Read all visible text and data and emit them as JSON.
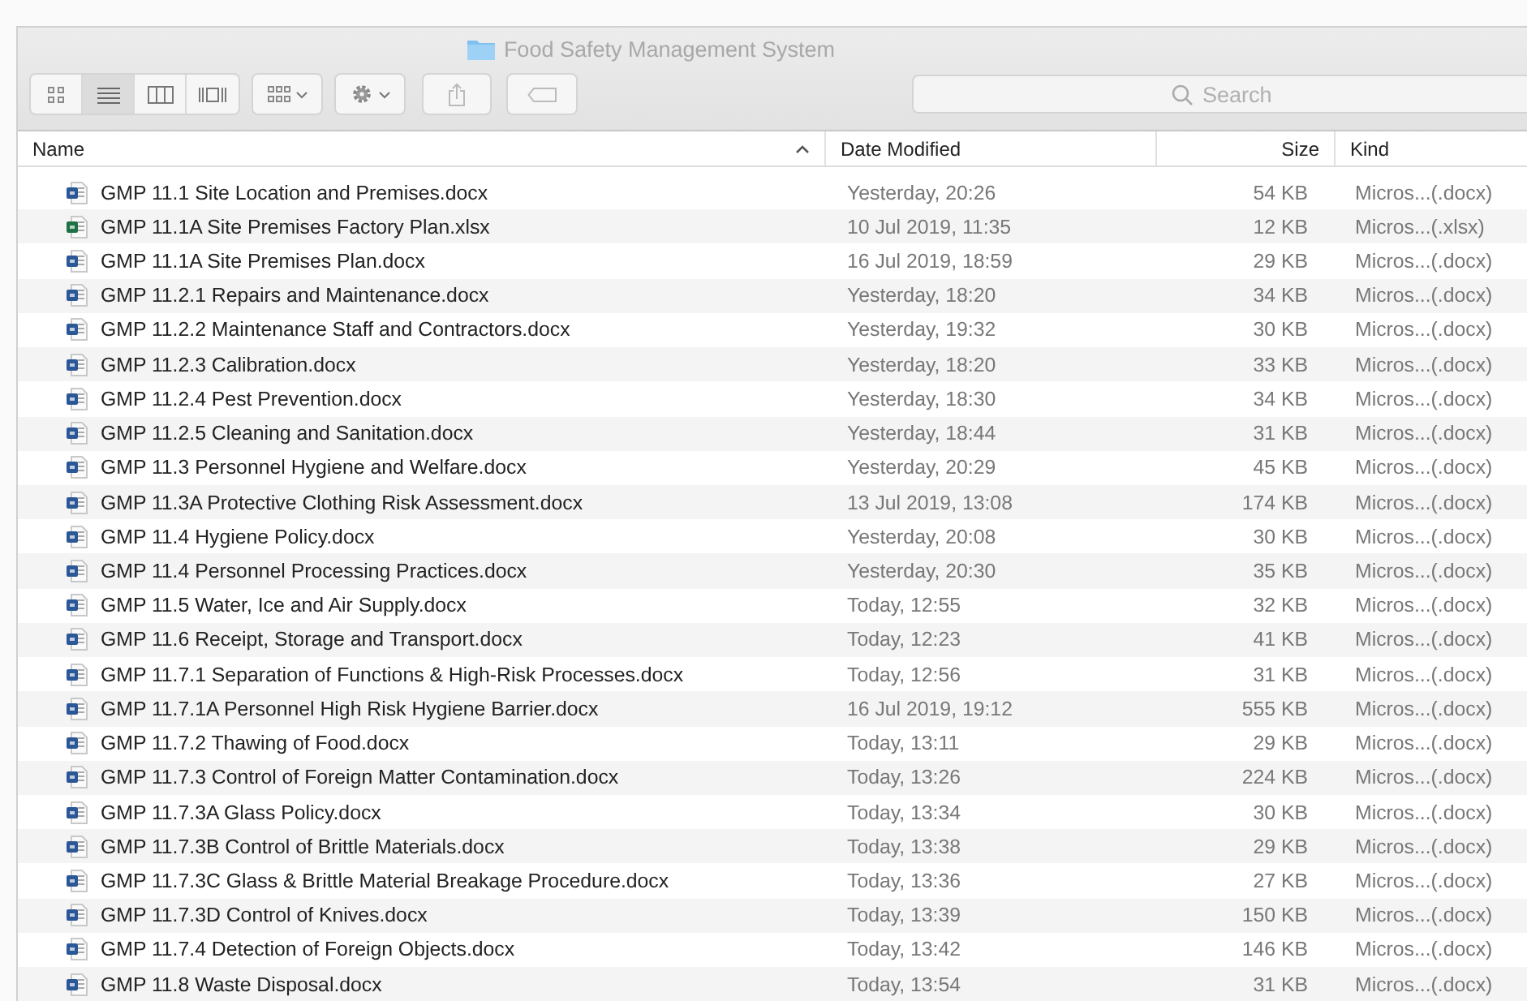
{
  "window": {
    "title": "Food Safety Management System"
  },
  "toolbar": {
    "views": [
      {
        "kind": "icons",
        "selected": false
      },
      {
        "kind": "list",
        "selected": true
      },
      {
        "kind": "columns",
        "selected": false
      },
      {
        "kind": "gallery",
        "selected": false
      }
    ],
    "search": {
      "placeholder": "Search"
    }
  },
  "table": {
    "columns": [
      {
        "label": "Name",
        "sorted": true
      },
      {
        "label": "Date Modified",
        "sorted": false
      },
      {
        "label": "Size",
        "sorted": false
      },
      {
        "label": "Kind",
        "sorted": false
      }
    ],
    "rows": [
      {
        "kind": "word",
        "name": "GMP 11.1 Site Location and Premises.docx",
        "date": "Yesterday, 20:26",
        "size": "54 KB",
        "kind_label": "Micros...(.docx)"
      },
      {
        "kind": "excel",
        "name": "GMP 11.1A Site Premises Factory Plan.xlsx",
        "date": "10 Jul 2019, 11:35",
        "size": "12 KB",
        "kind_label": "Micros...(.xlsx)"
      },
      {
        "kind": "word",
        "name": "GMP 11.1A Site Premises Plan.docx",
        "date": "16 Jul 2019, 18:59",
        "size": "29 KB",
        "kind_label": "Micros...(.docx)"
      },
      {
        "kind": "word",
        "name": "GMP 11.2.1 Repairs and Maintenance.docx",
        "date": "Yesterday, 18:20",
        "size": "34 KB",
        "kind_label": "Micros...(.docx)"
      },
      {
        "kind": "word",
        "name": "GMP 11.2.2 Maintenance Staff and Contractors.docx",
        "date": "Yesterday, 19:32",
        "size": "30 KB",
        "kind_label": "Micros...(.docx)"
      },
      {
        "kind": "word",
        "name": "GMP 11.2.3 Calibration.docx",
        "date": "Yesterday, 18:20",
        "size": "33 KB",
        "kind_label": "Micros...(.docx)"
      },
      {
        "kind": "word",
        "name": "GMP 11.2.4 Pest Prevention.docx",
        "date": "Yesterday, 18:30",
        "size": "34 KB",
        "kind_label": "Micros...(.docx)"
      },
      {
        "kind": "word",
        "name": "GMP 11.2.5 Cleaning and Sanitation.docx",
        "date": "Yesterday, 18:44",
        "size": "31 KB",
        "kind_label": "Micros...(.docx)"
      },
      {
        "kind": "word",
        "name": "GMP 11.3 Personnel Hygiene and Welfare.docx",
        "date": "Yesterday, 20:29",
        "size": "45 KB",
        "kind_label": "Micros...(.docx)"
      },
      {
        "kind": "word",
        "name": "GMP 11.3A Protective Clothing Risk Assessment.docx",
        "date": "13 Jul 2019, 13:08",
        "size": "174 KB",
        "kind_label": "Micros...(.docx)"
      },
      {
        "kind": "word",
        "name": "GMP 11.4 Hygiene Policy.docx",
        "date": "Yesterday, 20:08",
        "size": "30 KB",
        "kind_label": "Micros...(.docx)"
      },
      {
        "kind": "word",
        "name": "GMP 11.4 Personnel Processing Practices.docx",
        "date": "Yesterday, 20:30",
        "size": "35 KB",
        "kind_label": "Micros...(.docx)"
      },
      {
        "kind": "word",
        "name": "GMP 11.5 Water, Ice and Air Supply.docx",
        "date": "Today, 12:55",
        "size": "32 KB",
        "kind_label": "Micros...(.docx)"
      },
      {
        "kind": "word",
        "name": "GMP 11.6 Receipt, Storage and Transport.docx",
        "date": "Today, 12:23",
        "size": "41 KB",
        "kind_label": "Micros...(.docx)"
      },
      {
        "kind": "word",
        "name": "GMP 11.7.1 Separation of Functions & High-Risk Processes.docx",
        "date": "Today, 12:56",
        "size": "31 KB",
        "kind_label": "Micros...(.docx)"
      },
      {
        "kind": "word",
        "name": "GMP 11.7.1A Personnel High Risk Hygiene Barrier.docx",
        "date": "16 Jul 2019, 19:12",
        "size": "555 KB",
        "kind_label": "Micros...(.docx)"
      },
      {
        "kind": "word",
        "name": "GMP 11.7.2 Thawing of Food.docx",
        "date": "Today, 13:11",
        "size": "29 KB",
        "kind_label": "Micros...(.docx)"
      },
      {
        "kind": "word",
        "name": "GMP 11.7.3 Control of Foreign Matter Contamination.docx",
        "date": "Today, 13:26",
        "size": "224 KB",
        "kind_label": "Micros...(.docx)"
      },
      {
        "kind": "word",
        "name": "GMP 11.7.3A Glass Policy.docx",
        "date": "Today, 13:34",
        "size": "30 KB",
        "kind_label": "Micros...(.docx)"
      },
      {
        "kind": "word",
        "name": "GMP 11.7.3B Control of Brittle Materials.docx",
        "date": "Today, 13:38",
        "size": "29 KB",
        "kind_label": "Micros...(.docx)"
      },
      {
        "kind": "word",
        "name": "GMP 11.7.3C Glass & Brittle Material Breakage Procedure.docx",
        "date": "Today, 13:36",
        "size": "27 KB",
        "kind_label": "Micros...(.docx)"
      },
      {
        "kind": "word",
        "name": "GMP 11.7.3D Control of Knives.docx",
        "date": "Today, 13:39",
        "size": "150 KB",
        "kind_label": "Micros...(.docx)"
      },
      {
        "kind": "word",
        "name": "GMP 11.7.4 Detection of Foreign Objects.docx",
        "date": "Today, 13:42",
        "size": "146 KB",
        "kind_label": "Micros...(.docx)"
      },
      {
        "kind": "word",
        "name": "GMP 11.8 Waste Disposal.docx",
        "date": "Today, 13:54",
        "size": "31 KB",
        "kind_label": "Micros...(.docx)"
      }
    ]
  }
}
